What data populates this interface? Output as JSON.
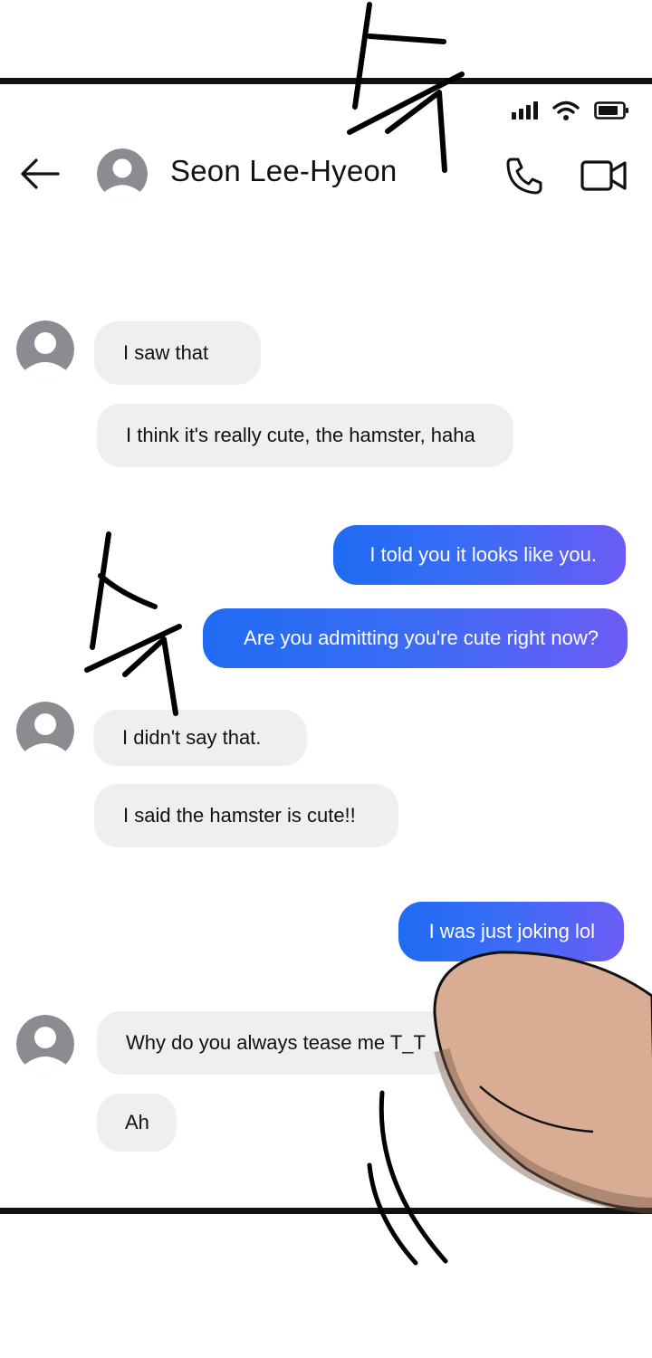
{
  "header": {
    "contact_name": "Seon Lee-Hyeon",
    "back_icon": "arrow-left-icon",
    "call_icon": "phone-icon",
    "video_icon": "video-camera-icon"
  },
  "status_bar": {
    "icons": [
      "signal-icon",
      "wifi-icon",
      "battery-icon"
    ]
  },
  "colors": {
    "incoming_bubble": "#efefef",
    "outgoing_gradient_start": "#1f6bf2",
    "outgoing_gradient_end": "#6c5cf5",
    "avatar_gray": "#8a8c92"
  },
  "messages": [
    {
      "from": "contact",
      "text": "I saw that"
    },
    {
      "from": "contact",
      "text": "I think it's really cute, the hamster, haha"
    },
    {
      "from": "me",
      "text": "I told you it looks like you."
    },
    {
      "from": "me",
      "text": "Are you admitting you're cute right now?"
    },
    {
      "from": "contact",
      "text": "I didn't say that."
    },
    {
      "from": "contact",
      "text": "I said the hamster is cute!!"
    },
    {
      "from": "me",
      "text": "I was just joking lol"
    },
    {
      "from": "contact",
      "text": "Why do you always tease me T_T"
    },
    {
      "from": "contact",
      "text": "Ah"
    }
  ]
}
